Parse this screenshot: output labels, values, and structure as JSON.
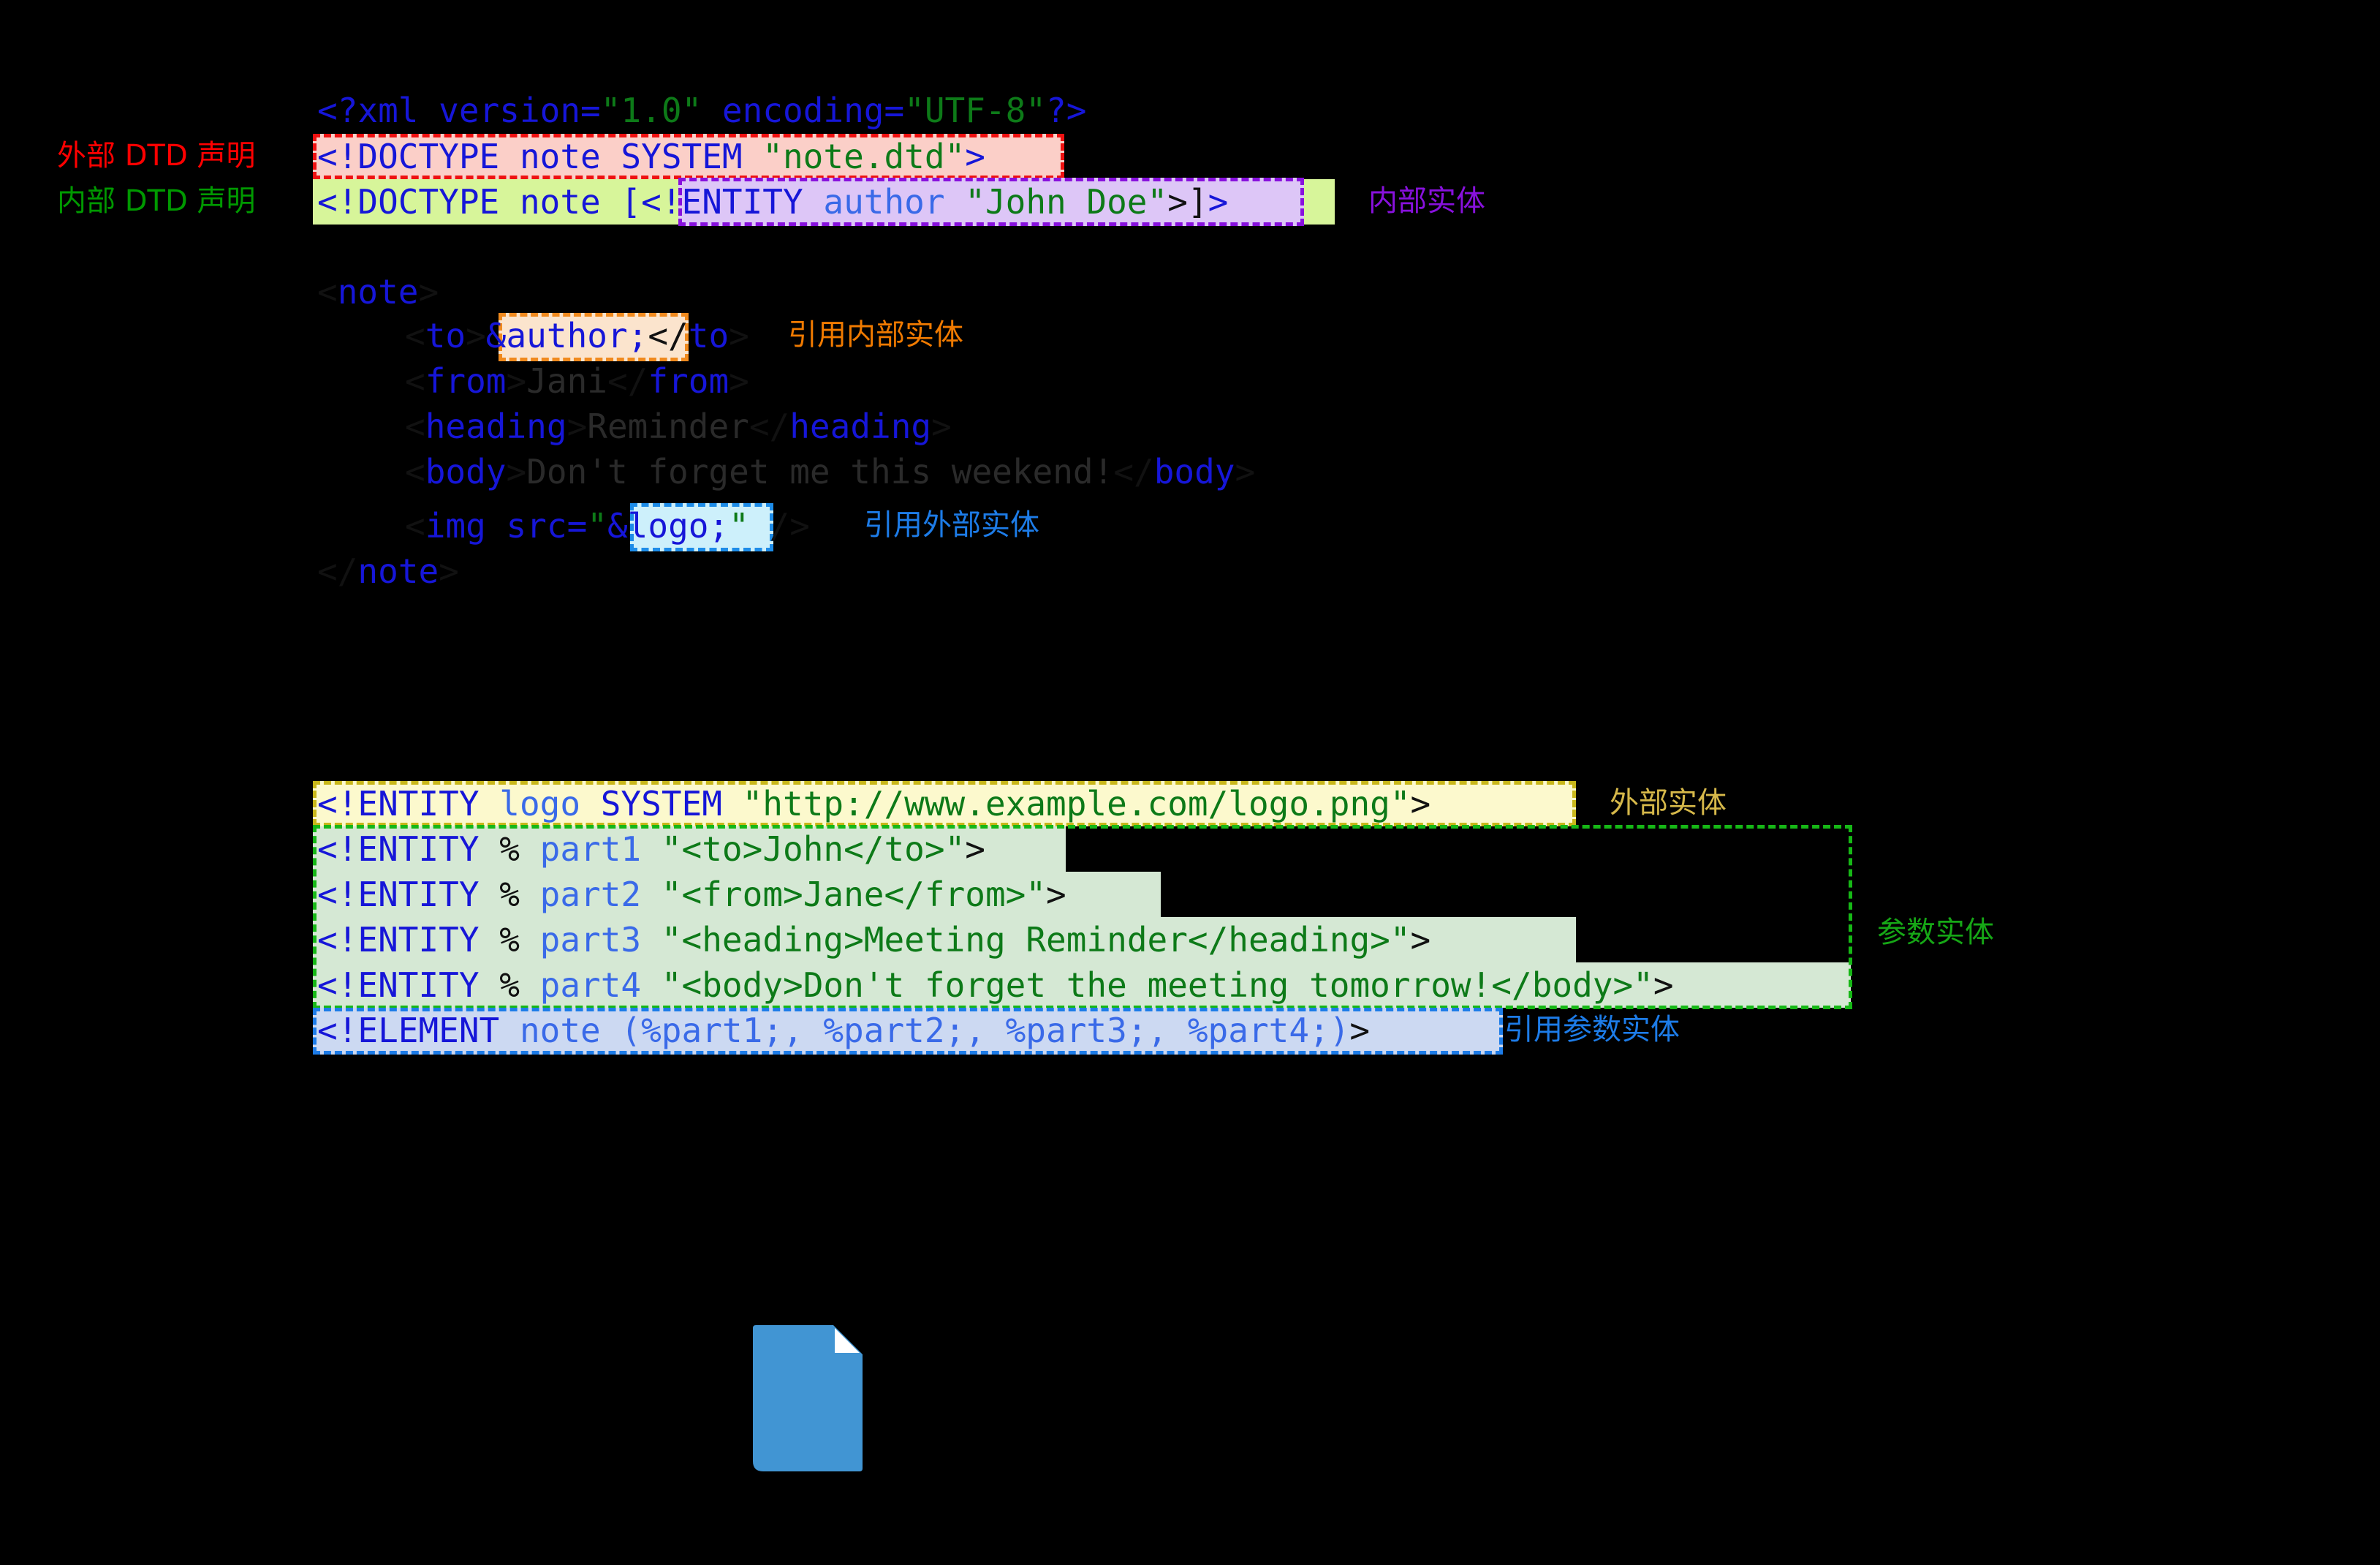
{
  "meta": {
    "background": "#000000",
    "accent_blue": "#1616d8",
    "accent_green": "#0d7a18"
  },
  "labels": {
    "external_dtd": "外部 DTD 声明",
    "internal_dtd": "内部 DTD 声明",
    "internal_entity": "内部实体",
    "ref_internal_entity": "引用内部实体",
    "ref_external_entity": "引用外部实体",
    "external_entity": "外部实体",
    "parameter_entity": "参数实体",
    "ref_parameter_entity": "引用参数实体"
  },
  "xml_document": {
    "prolog": {
      "open": "<?xml",
      "attr1_name": " version=",
      "attr1_value": "\"1.0\"",
      "attr2_name": " encoding=",
      "attr2_value": "\"UTF-8\"",
      "close": "?>"
    },
    "external_doctype": {
      "keyword": "<!DOCTYPE",
      "root": " note",
      "kind": " SYSTEM ",
      "sysid": "\"note.dtd\"",
      "close": ">"
    },
    "internal_doctype": {
      "keyword": "<!DOCTYPE",
      "root": " note",
      "bracket_open": " [",
      "entity_keyword": "<!ENTITY",
      "entity_name": " author ",
      "entity_value": "\"John Doe\"",
      "entity_close": ">",
      "bracket_close": "]",
      "close": ">"
    },
    "body_lines": [
      {
        "id": "note-open",
        "open_lt": "<",
        "tag": "note",
        "open_gt": ">"
      },
      {
        "id": "to",
        "open_lt": "<",
        "tag": "to",
        "open_gt": ">",
        "entity_ref": "&author;",
        "close_lt": "</",
        "close_tag": "to",
        "close_gt": ">"
      },
      {
        "id": "from",
        "open_lt": "<",
        "tag": "from",
        "open_gt": ">",
        "text": "Jani",
        "close_lt": "</",
        "close_tag": "from",
        "close_gt": ">"
      },
      {
        "id": "heading",
        "open_lt": "<",
        "tag": "heading",
        "open_gt": ">",
        "text": "Reminder",
        "close_lt": "</",
        "close_tag": "heading",
        "close_gt": ">"
      },
      {
        "id": "body",
        "open_lt": "<",
        "tag": "body",
        "open_gt": ">",
        "text": "Don't forget me this weekend!",
        "close_lt": "</",
        "close_tag": "body",
        "close_gt": ">"
      },
      {
        "id": "img",
        "open_lt": "<",
        "tag": "img",
        "attr": " src=",
        "quote_open": "\"",
        "entity_ref": "&logo;",
        "quote_close": "\"",
        "selfclose": " />"
      },
      {
        "id": "note-close",
        "close_lt": "</",
        "tag": "note",
        "close_gt": ">"
      }
    ]
  },
  "dtd_block": {
    "external_entity_line": {
      "keyword": "<!ENTITY",
      "name": " logo",
      "kind": " SYSTEM ",
      "value": "\"http://www.example.com/logo.png\"",
      "close": ">"
    },
    "parameter_entities": [
      {
        "keyword": "<!ENTITY",
        "percent": " % ",
        "name": "part1",
        "space": " ",
        "value": "\"<to>John</to>\"",
        "close": ">"
      },
      {
        "keyword": "<!ENTITY",
        "percent": " % ",
        "name": "part2",
        "space": " ",
        "value": "\"<from>Jane</from>\"",
        "close": ">"
      },
      {
        "keyword": "<!ENTITY",
        "percent": " % ",
        "name": "part3",
        "space": " ",
        "value": "\"<heading>Meeting Reminder</heading>\"",
        "close": ">"
      },
      {
        "keyword": "<!ENTITY",
        "percent": " % ",
        "name": "part4",
        "space": " ",
        "value": "\"<body>Don't forget the meeting tomorrow!</body>\"",
        "close": ">"
      }
    ],
    "element_line": {
      "keyword": "<!ELEMENT",
      "name": " note ",
      "content": "(%part1;, %part2;, %part3;, %part4;)",
      "close": ">"
    }
  },
  "file_icon": {
    "name": "document-file-icon",
    "color": "#4195d3",
    "fold_color": "#ffffff"
  }
}
